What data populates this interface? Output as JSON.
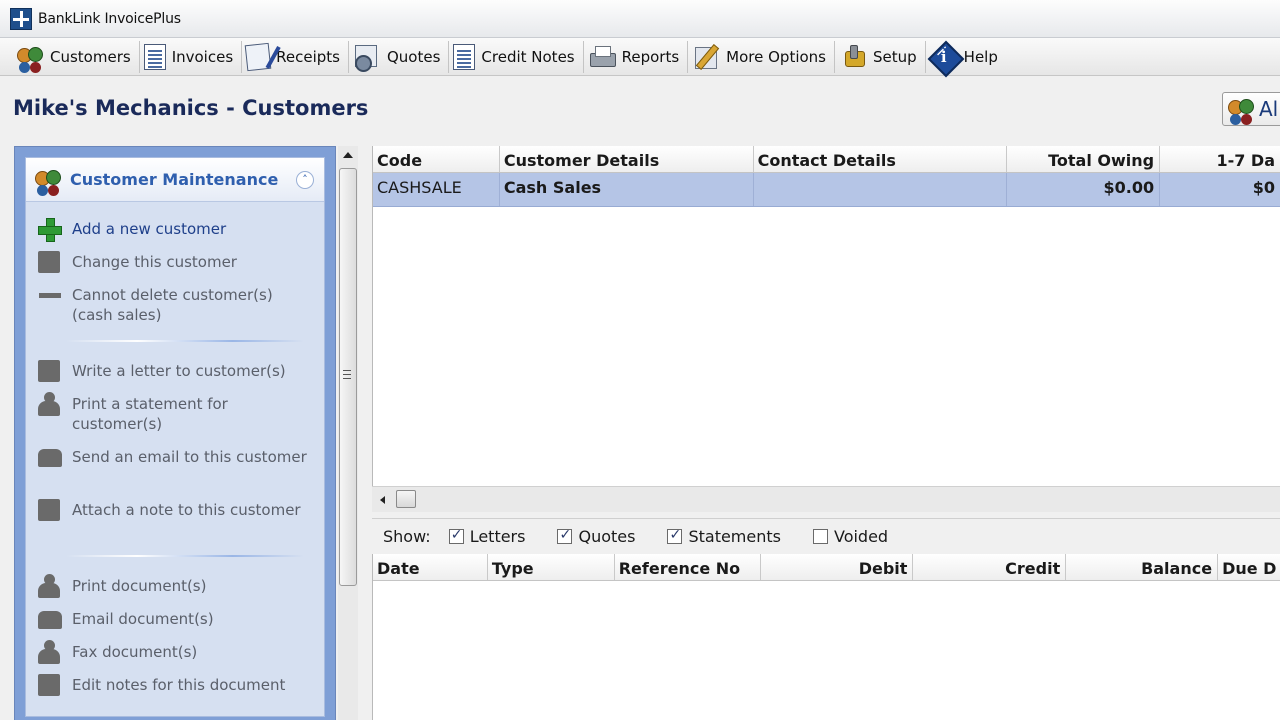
{
  "window": {
    "title": "BankLink InvoicePlus"
  },
  "toolbar": {
    "items": [
      {
        "label": "Customers",
        "icon": "customers-icon"
      },
      {
        "label": "Invoices",
        "icon": "invoice-doc-icon"
      },
      {
        "label": "Receipts",
        "icon": "receipt-icon"
      },
      {
        "label": "Quotes",
        "icon": "quote-icon"
      },
      {
        "label": "Credit Notes",
        "icon": "credit-note-icon"
      },
      {
        "label": "Reports",
        "icon": "printer-icon"
      },
      {
        "label": "More Options",
        "icon": "pencil-icon"
      },
      {
        "label": "Setup",
        "icon": "setup-icon"
      },
      {
        "label": "Help",
        "icon": "help-info-icon"
      }
    ]
  },
  "header": {
    "title": "Mike's Mechanics - Customers",
    "right_button_label": "Al"
  },
  "taskpane": {
    "title": "Customer Maintenance",
    "collapse_glyph": "˄",
    "groups": [
      [
        {
          "label": "Add a new customer",
          "enabled": true,
          "icon": "add-plus-icon"
        },
        {
          "label": "Change this customer",
          "enabled": false,
          "icon": "edit-icon"
        },
        {
          "label": "Cannot delete customer(s) (cash sales)",
          "enabled": false,
          "icon": "minus-icon"
        }
      ],
      [
        {
          "label": "Write a letter to customer(s)",
          "enabled": false,
          "icon": "letter-icon"
        },
        {
          "label": "Print a statement for customer(s)",
          "enabled": false,
          "icon": "print-person-icon"
        },
        {
          "label": "Send an email to this customer",
          "enabled": false,
          "icon": "email-icon"
        },
        {
          "label": "Attach a note to this customer",
          "enabled": false,
          "icon": "note-icon"
        }
      ],
      [
        {
          "label": "Print document(s)",
          "enabled": false,
          "icon": "print-doc-icon"
        },
        {
          "label": "Email document(s)",
          "enabled": false,
          "icon": "email-doc-icon"
        },
        {
          "label": "Fax document(s)",
          "enabled": false,
          "icon": "fax-icon"
        },
        {
          "label": "Edit notes for this document",
          "enabled": false,
          "icon": "edit-notes-icon"
        }
      ]
    ]
  },
  "customers_grid": {
    "columns": [
      "Code",
      "Customer Details",
      "Contact Details",
      "Total Owing",
      "1-7 Da"
    ],
    "rows": [
      {
        "code": "CASHSALE",
        "customer_details": "Cash Sales",
        "contact_details": "",
        "total_owing": "$0.00",
        "days_1_7": "$0"
      }
    ]
  },
  "show_filter": {
    "label": "Show:",
    "options": [
      {
        "label": "Letters",
        "checked": true
      },
      {
        "label": "Quotes",
        "checked": true
      },
      {
        "label": "Statements",
        "checked": true
      },
      {
        "label": "Voided",
        "checked": false
      }
    ]
  },
  "transactions_grid": {
    "columns": [
      "Date",
      "Type",
      "Reference No",
      "Debit",
      "Credit",
      "Balance",
      "Due D"
    ]
  },
  "colors": {
    "selected_row": "#b5c5e6",
    "taskpane_border": "#7f9fd6",
    "taskpane_bg": "#d6e0f1",
    "title_text": "#1a2a5a",
    "link_text": "#1e3f8a"
  }
}
